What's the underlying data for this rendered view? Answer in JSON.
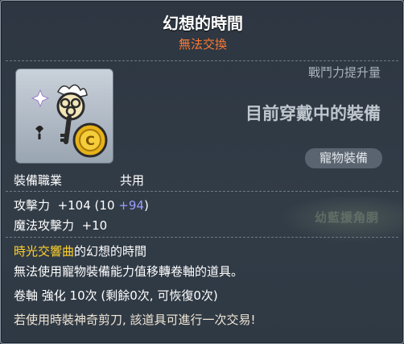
{
  "item": {
    "name": "幻想的時間",
    "trade_status": "無法交換",
    "stat_label": "戰鬥力提升量",
    "equipped_text": "目前穿戴中的裝備",
    "category_badge": "寵物裝備",
    "job_label": "裝備職業",
    "job_value": "共用"
  },
  "stats": {
    "attack_label": "攻擊力",
    "attack_total": "+104",
    "attack_base_open": "(10",
    "attack_bonus": "+94",
    "attack_close": ")",
    "magic_label": "魔法攻擊力",
    "magic_value": "+10"
  },
  "description": {
    "set_name": "時光交響曲",
    "set_suffix": "的幻想的時間",
    "line2": "無法使用寵物裝備能力值移轉卷軸的道具。",
    "line3": "卷軸 強化 10次 (剩餘0次, 可恢復0次)",
    "line4": "若使用時裝神奇剪刀, 該道具可進行一次交易!"
  },
  "background": {
    "ghost_text": "幼藍援角胴"
  },
  "colors": {
    "trade_status": "#ff7a33",
    "bonus": "#9d9dff",
    "set_name": "#ffd22d"
  },
  "icons": {
    "item_icon": "key-with-gold-coin-icon"
  }
}
